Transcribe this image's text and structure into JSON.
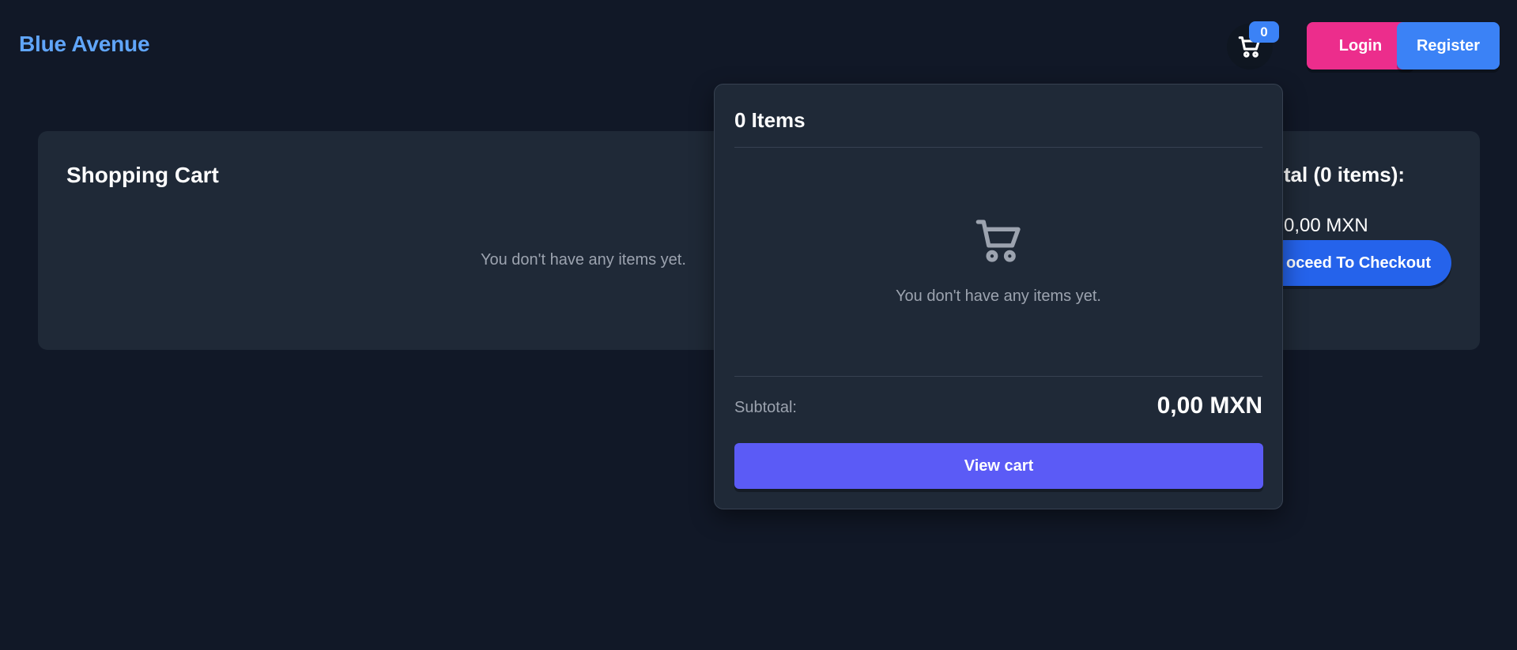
{
  "header": {
    "brand": "Blue Avenue",
    "cart_count": "0",
    "login_label": "Login",
    "register_label": "Register"
  },
  "main": {
    "title": "Shopping Cart",
    "empty_message": "You don't have any items yet.",
    "summary_title": "otal (0 items):",
    "summary_amount": "0,00 MXN",
    "checkout_label": "oceed To Checkout"
  },
  "dropdown": {
    "title": "0 Items",
    "empty_message": "You don't have any items yet.",
    "subtotal_label": "Subtotal:",
    "subtotal_value": "0,00 MXN",
    "view_cart_label": "View cart"
  },
  "icons": {
    "cart_button": "shopping-cart-icon",
    "empty_cart": "shopping-cart-icon"
  },
  "colors": {
    "background": "#111827",
    "card": "#1f2937",
    "brand": "#60a5fa",
    "login": "#ec2d8c",
    "register": "#3b82f6",
    "checkout": "#2563eb",
    "view_cart": "#5b5bf6"
  }
}
